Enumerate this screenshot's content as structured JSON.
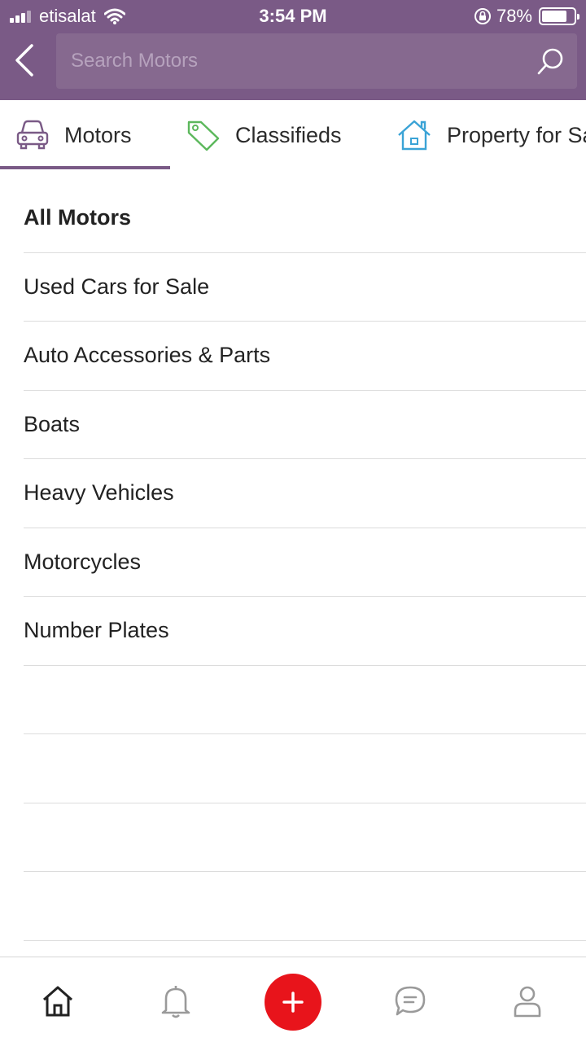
{
  "status_bar": {
    "carrier": "etisalat",
    "time": "3:54 PM",
    "battery_percent": "78%",
    "battery_level": 0.78,
    "icons": [
      "signal-icon",
      "wifi-icon",
      "rotation-lock-icon",
      "battery-icon"
    ]
  },
  "header": {
    "back_icon": "chevron-left-icon",
    "search_placeholder": "Search Motors",
    "search_value": "",
    "search_icon": "search-icon",
    "background_color": "#7a5a86"
  },
  "tabs": [
    {
      "label": "Motors",
      "icon": "car-icon",
      "active": true,
      "icon_color": "#7a5a86"
    },
    {
      "label": "Classifieds",
      "icon": "tag-icon",
      "active": false,
      "icon_color": "#5cb85c"
    },
    {
      "label": "Property for Sale",
      "icon": "house-icon",
      "active": false,
      "icon_color": "#3aa3d6"
    }
  ],
  "categories": [
    {
      "label": "All Motors",
      "bold": true
    },
    {
      "label": "Used Cars for Sale",
      "bold": false
    },
    {
      "label": "Auto Accessories & Parts",
      "bold": false
    },
    {
      "label": "Boats",
      "bold": false
    },
    {
      "label": "Heavy Vehicles",
      "bold": false
    },
    {
      "label": "Motorcycles",
      "bold": false
    },
    {
      "label": "Number Plates",
      "bold": false
    }
  ],
  "bottom_nav": {
    "items": [
      "home-icon",
      "bell-icon",
      "post-ad-icon",
      "chat-icon",
      "profile-icon"
    ],
    "post_button_color": "#e8141b"
  }
}
